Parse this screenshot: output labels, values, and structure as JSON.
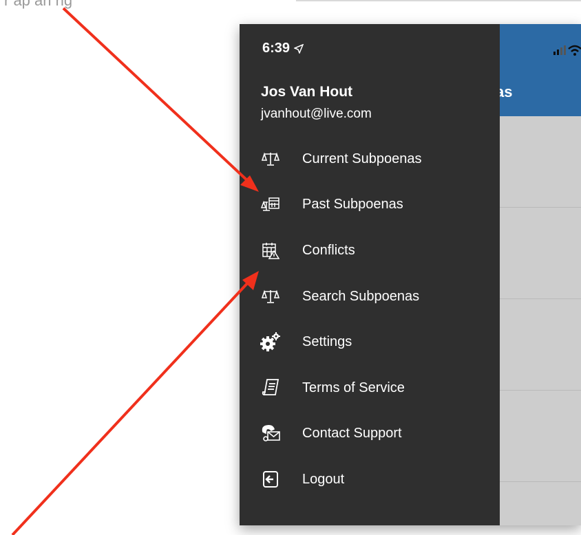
{
  "fragments": {
    "left": "r ap an ng"
  },
  "status_bar": {
    "time": "6:39"
  },
  "header": {
    "title": "as"
  },
  "user": {
    "name": "Jos Van Hout",
    "email": "jvanhout@live.com"
  },
  "menu": [
    {
      "label": "Current Subpoenas",
      "icon": "scales-icon"
    },
    {
      "label": "Past Subpoenas",
      "icon": "scales-calendar-icon"
    },
    {
      "label": "Conflicts",
      "icon": "calendar-warning-icon"
    },
    {
      "label": "Search Subpoenas",
      "icon": "scales-icon"
    },
    {
      "label": "Settings",
      "icon": "gears-icon"
    },
    {
      "label": "Terms of Service",
      "icon": "document-icon"
    },
    {
      "label": "Contact Support",
      "icon": "phone-mail-icon"
    },
    {
      "label": "Logout",
      "icon": "logout-icon"
    }
  ],
  "colors": {
    "drawer_bg": "#2f2f2f",
    "header_bg": "#2c6aa5",
    "list_bg": "#cdcdcd",
    "annotation_arrow": "#f0301c"
  }
}
